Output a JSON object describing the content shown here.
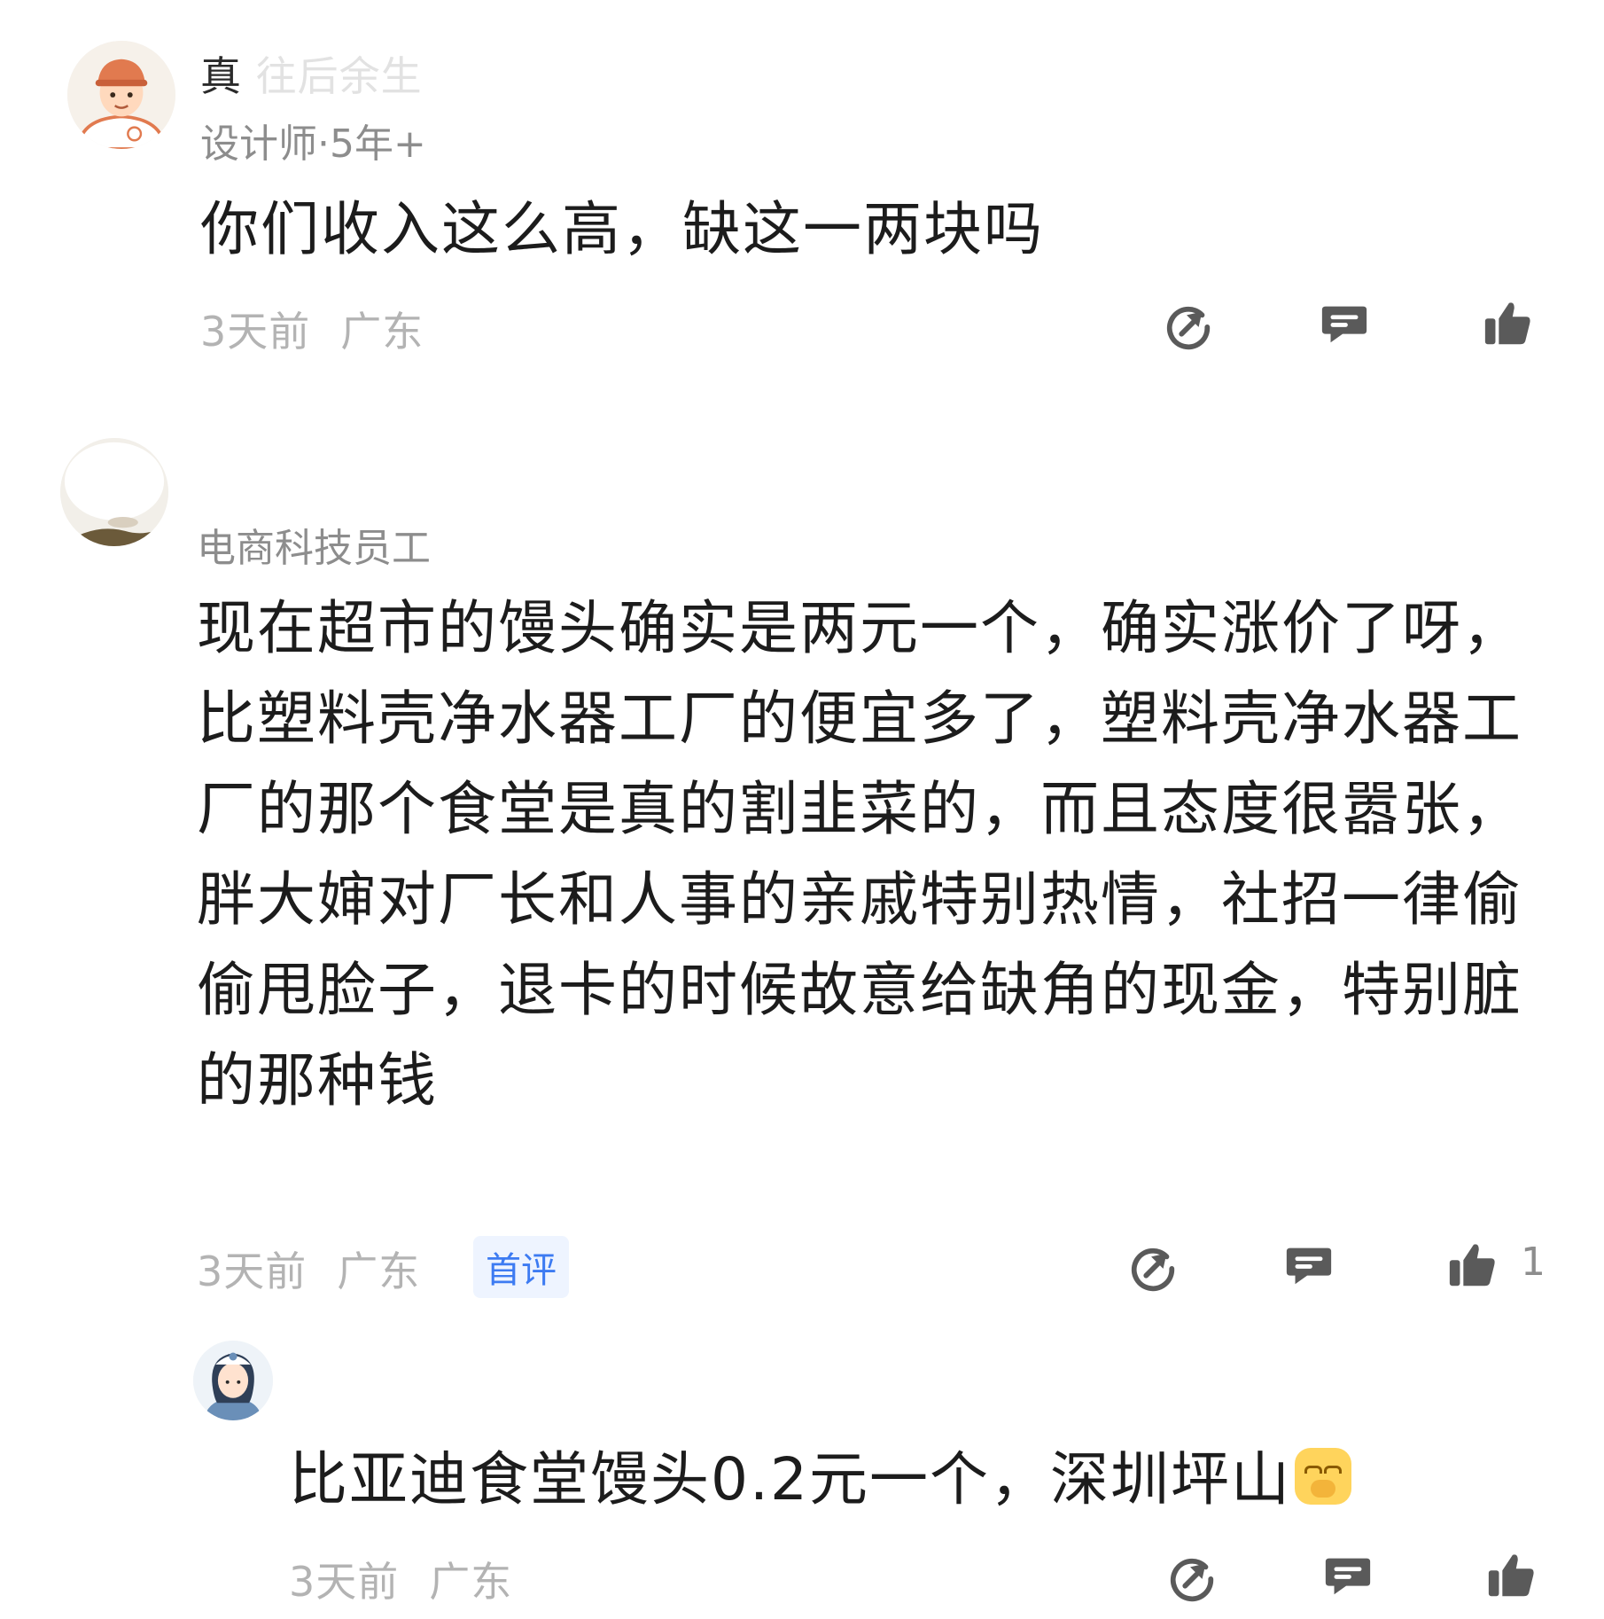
{
  "comments": [
    {
      "username": "真",
      "username_faded": "  往后余生",
      "user_title": "设计师·5年+",
      "text": "你们收入这么高，缺这一两块吗",
      "time": "3天前",
      "location": "广东",
      "likes": ""
    },
    {
      "username": "",
      "user_title": "电商科技员工",
      "text": "现在超市的馒头确实是两元一个，确实涨价了呀，比塑料壳净水器工厂的便宜多了，塑料壳净水器工厂的那个食堂是真的割韭菜的，而且态度很嚣张，胖大婶对厂长和人事的亲戚特别热情，社招一律偷偷甩脸子，退卡的时候故意给缺角的现金，特别脏的那种钱",
      "time": "3天前",
      "location": "广东",
      "badge": "首评",
      "likes": "1"
    },
    {
      "username": "",
      "text": "比亚迪食堂馒头0.2元一个，深圳坪山",
      "time": "3天前",
      "location": "广东",
      "likes": ""
    }
  ],
  "icons": {
    "share": "share-icon",
    "reply": "comment-icon",
    "like": "thumbs-up-icon"
  },
  "colors": {
    "badge_bg": "#eef4ff",
    "badge_text": "#3d7bf2",
    "meta": "#b3b3b3",
    "icon": "#5a5a5a"
  }
}
